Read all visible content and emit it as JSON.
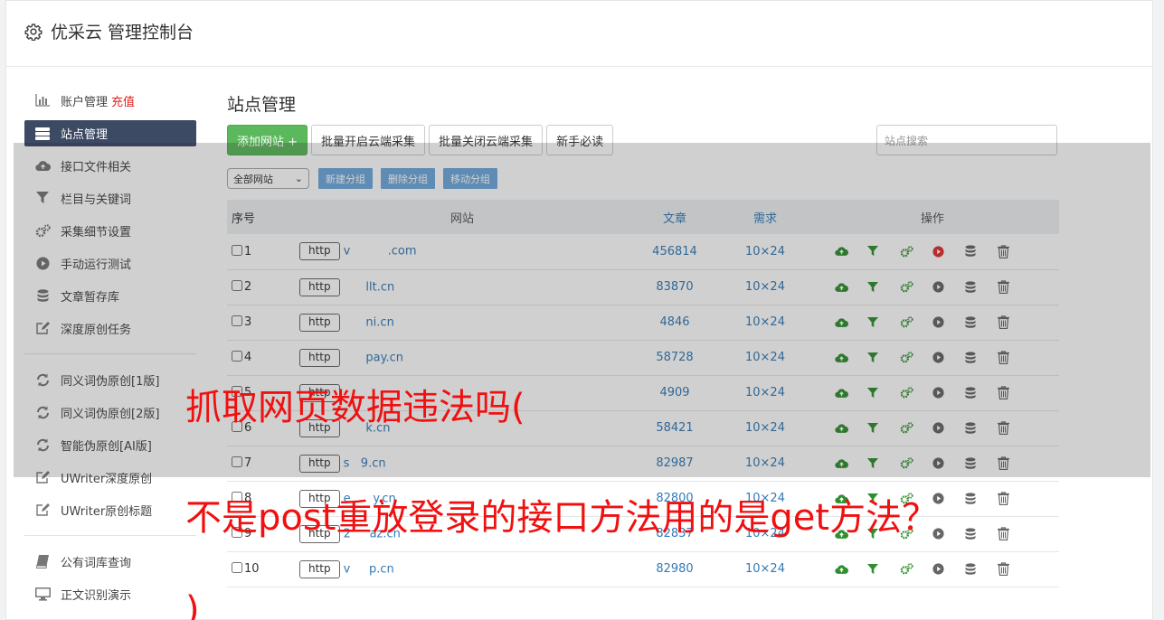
{
  "app": {
    "title": "优采云 管理控制台"
  },
  "sidebar": {
    "group1": [
      {
        "label": "账户管理",
        "extra": "充值",
        "icon": "bar-chart-icon"
      },
      {
        "label": "站点管理",
        "icon": "server-icon",
        "active": true
      },
      {
        "label": "接口文件相关",
        "icon": "cloud-upload-icon"
      },
      {
        "label": "栏目与关键词",
        "icon": "filter-icon"
      },
      {
        "label": "采集细节设置",
        "icon": "cogs-icon"
      },
      {
        "label": "手动运行测试",
        "icon": "play-icon"
      },
      {
        "label": "文章暂存库",
        "icon": "database-icon"
      },
      {
        "label": "深度原创任务",
        "icon": "edit-icon"
      }
    ],
    "group2": [
      {
        "label": "同义词伪原创[1版]",
        "icon": "refresh-icon"
      },
      {
        "label": "同义词伪原创[2版]",
        "icon": "refresh-icon"
      },
      {
        "label": "智能伪原创[AI版]",
        "icon": "refresh-icon"
      },
      {
        "label": "UWriter深度原创",
        "icon": "edit-icon"
      },
      {
        "label": "UWriter原创标题",
        "icon": "edit-icon"
      }
    ],
    "group3": [
      {
        "label": "公有词库查询",
        "icon": "book-icon"
      },
      {
        "label": "正文识别演示",
        "icon": "monitor-icon"
      }
    ]
  },
  "main": {
    "title": "站点管理",
    "toolbar": {
      "add": "添加网站 +",
      "batch_open": "批量开启云端采集",
      "batch_close": "批量关闭云端采集",
      "guide": "新手必读",
      "search_placeholder": "站点搜索"
    },
    "filter": {
      "group_select": "全部网站",
      "new_group": "新建分组",
      "delete_group": "删除分组",
      "move_group": "移动分组"
    },
    "table": {
      "headers": {
        "no": "序号",
        "site": "网站",
        "articles": "文章",
        "demand": "需求",
        "ops": "操作"
      },
      "rows": [
        {
          "no": "1",
          "protocol": "http",
          "domain": "v          .com",
          "articles": "456814",
          "demand": "10×24",
          "running": true
        },
        {
          "no": "2",
          "protocol": "http",
          "domain": "      llt.cn",
          "articles": "83870",
          "demand": "10×24",
          "running": false
        },
        {
          "no": "3",
          "protocol": "http",
          "domain": "      ni.cn",
          "articles": "4846",
          "demand": "10×24",
          "running": false
        },
        {
          "no": "4",
          "protocol": "http",
          "domain": "      pay.cn",
          "articles": "58728",
          "demand": "10×24",
          "running": false
        },
        {
          "no": "5",
          "protocol": "http",
          "domain": "           ",
          "articles": "4909",
          "demand": "10×24",
          "running": false
        },
        {
          "no": "6",
          "protocol": "http",
          "domain": "      k.cn",
          "articles": "58421",
          "demand": "10×24",
          "running": false
        },
        {
          "no": "7",
          "protocol": "http",
          "domain": "s   9.cn",
          "articles": "82987",
          "demand": "10×24",
          "running": false
        },
        {
          "no": "8",
          "protocol": "http",
          "domain": "e      y.cn",
          "articles": "82800",
          "demand": "10×24",
          "running": false
        },
        {
          "no": "9",
          "protocol": "http",
          "domain": "2     az.cn",
          "articles": "82837",
          "demand": "10×24",
          "running": false
        },
        {
          "no": "10",
          "protocol": "http",
          "domain": "v     p.cn",
          "articles": "82980",
          "demand": "10×24",
          "running": false
        }
      ]
    }
  },
  "captions": {
    "line1": "抓取网页数据违法吗(",
    "line2": "不是post重放登录的接口方法用的是get方法？",
    "line3": ")"
  },
  "colors": {
    "sidebar_active": "#3d4a63",
    "link": "#337ab7",
    "green": "#5cb85c",
    "caption": "#f01010",
    "recharge": "#e02020"
  }
}
